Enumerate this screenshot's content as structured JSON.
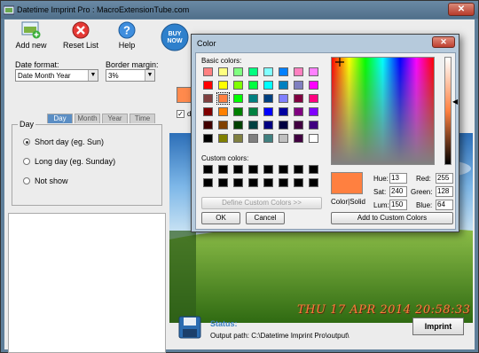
{
  "window": {
    "title": "Datetime Imprint Pro : MacroExtensionTube.com",
    "close": "✕"
  },
  "toolbar": {
    "add_new": "Add new",
    "reset_list": "Reset List",
    "help": "Help",
    "buy_now_line1": "BUY",
    "buy_now_line2": "NOW"
  },
  "settings": {
    "date_format_label": "Date format:",
    "date_format_value": "Date Month Year",
    "border_margin_label": "Border margin:",
    "border_margin_value": "3%"
  },
  "tabs": [
    "Day",
    "Month",
    "Year",
    "Time"
  ],
  "day_group": {
    "title": "Day",
    "options": [
      "Short day (eg. Sun)",
      "Long day (eg. Sunday)",
      "Not show"
    ],
    "selected_index": 0
  },
  "preview": {
    "checkbox_mark": "✓",
    "checkbox_partial_text": "d",
    "date_stamp": "THU 17 APR 2014 20:58:33"
  },
  "status": {
    "label": "Status:",
    "output_path": "Output path: C:\\Datetime Imprint Pro\\output\\",
    "imprint_button": "Imprint"
  },
  "color_dialog": {
    "title": "Color",
    "close": "✕",
    "basic_colors_label": "Basic colors:",
    "custom_colors_label": "Custom colors:",
    "define_custom_button": "Define Custom Colors >>",
    "ok_button": "OK",
    "cancel_button": "Cancel",
    "color_solid_label": "Color|Solid",
    "add_custom_button": "Add to Custom Colors",
    "hue_label": "Hue:",
    "hue_value": "13",
    "sat_label": "Sat:",
    "sat_value": "240",
    "lum_label": "Lum:",
    "lum_value": "150",
    "red_label": "Red:",
    "red_value": "255",
    "green_label": "Green:",
    "green_value": "128",
    "blue_label": "Blue:",
    "blue_value": "64",
    "selected_color": "#ff8040",
    "basic_colors": [
      [
        "#ff8080",
        "#ffff80",
        "#80ff80",
        "#00ff80",
        "#80ffff",
        "#0080ff",
        "#ff80c0",
        "#ff80ff"
      ],
      [
        "#ff0000",
        "#ffff00",
        "#80ff00",
        "#00ff40",
        "#00ffff",
        "#0080c0",
        "#8080c0",
        "#ff00ff"
      ],
      [
        "#804040",
        "#ff8040",
        "#00ff00",
        "#008080",
        "#004080",
        "#8080ff",
        "#800040",
        "#ff0080"
      ],
      [
        "#800000",
        "#ff8000",
        "#008000",
        "#008040",
        "#0000ff",
        "#0000a0",
        "#800080",
        "#8000ff"
      ],
      [
        "#400000",
        "#804000",
        "#004000",
        "#004040",
        "#000080",
        "#000040",
        "#400040",
        "#400080"
      ],
      [
        "#000000",
        "#808000",
        "#808040",
        "#808080",
        "#408080",
        "#c0c0c0",
        "#400040",
        "#ffffff"
      ]
    ],
    "selected_swatch": [
      2,
      1
    ]
  }
}
